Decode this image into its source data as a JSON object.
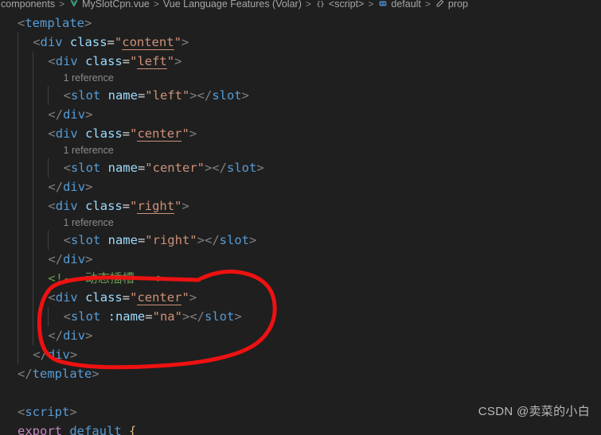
{
  "breadcrumb": {
    "segments": [
      {
        "label": "components",
        "icon": "folder-icon",
        "show_icon": false
      },
      {
        "label": "MySlotCpn.vue",
        "icon": "vue-file-icon",
        "show_icon": true
      },
      {
        "label": "Vue Language Features (Volar)",
        "icon": "extension-icon",
        "show_icon": false
      },
      {
        "label": "<script>",
        "icon": "braces-icon",
        "show_icon": true
      },
      {
        "label": "default",
        "icon": "symbol-object-icon",
        "show_icon": true
      },
      {
        "label": "prop",
        "icon": "symbol-property-icon",
        "show_icon": true
      }
    ],
    "separator": ">"
  },
  "editor": {
    "language": "vue",
    "lines": [
      {
        "type": "code",
        "indent": 1,
        "tokens": [
          {
            "text": "<",
            "cls": "t-bracket"
          },
          {
            "text": "template",
            "cls": "t-tag"
          },
          {
            "text": ">",
            "cls": "t-bracket"
          }
        ]
      },
      {
        "type": "code",
        "indent": 2,
        "tokens": [
          {
            "text": "<",
            "cls": "t-bracket"
          },
          {
            "text": "div",
            "cls": "t-tag"
          },
          {
            "text": " ",
            "cls": "t-eq"
          },
          {
            "text": "class",
            "cls": "t-attr"
          },
          {
            "text": "=",
            "cls": "t-eq"
          },
          {
            "text": "\"",
            "cls": "t-quote"
          },
          {
            "text": "content",
            "cls": "t-str-u"
          },
          {
            "text": "\"",
            "cls": "t-quote"
          },
          {
            "text": ">",
            "cls": "t-bracket"
          }
        ]
      },
      {
        "type": "code",
        "indent": 3,
        "tokens": [
          {
            "text": "<",
            "cls": "t-bracket"
          },
          {
            "text": "div",
            "cls": "t-tag"
          },
          {
            "text": " ",
            "cls": "t-eq"
          },
          {
            "text": "class",
            "cls": "t-attr"
          },
          {
            "text": "=",
            "cls": "t-eq"
          },
          {
            "text": "\"",
            "cls": "t-quote"
          },
          {
            "text": "left",
            "cls": "t-str-u"
          },
          {
            "text": "\"",
            "cls": "t-quote"
          },
          {
            "text": ">",
            "cls": "t-bracket"
          }
        ]
      },
      {
        "type": "codelens",
        "indent": 4,
        "text": "1 reference"
      },
      {
        "type": "code",
        "indent": 4,
        "tokens": [
          {
            "text": "<",
            "cls": "t-bracket"
          },
          {
            "text": "slot",
            "cls": "t-tag"
          },
          {
            "text": " ",
            "cls": "t-eq"
          },
          {
            "text": "name",
            "cls": "t-attr"
          },
          {
            "text": "=",
            "cls": "t-eq"
          },
          {
            "text": "\"",
            "cls": "t-quote"
          },
          {
            "text": "left",
            "cls": "t-str"
          },
          {
            "text": "\"",
            "cls": "t-quote"
          },
          {
            "text": ">",
            "cls": "t-bracket"
          },
          {
            "text": "</",
            "cls": "t-bracket"
          },
          {
            "text": "slot",
            "cls": "t-tag"
          },
          {
            "text": ">",
            "cls": "t-bracket"
          }
        ]
      },
      {
        "type": "code",
        "indent": 3,
        "tokens": [
          {
            "text": "</",
            "cls": "t-bracket"
          },
          {
            "text": "div",
            "cls": "t-tag"
          },
          {
            "text": ">",
            "cls": "t-bracket"
          }
        ]
      },
      {
        "type": "code",
        "indent": 3,
        "tokens": [
          {
            "text": "<",
            "cls": "t-bracket"
          },
          {
            "text": "div",
            "cls": "t-tag"
          },
          {
            "text": " ",
            "cls": "t-eq"
          },
          {
            "text": "class",
            "cls": "t-attr"
          },
          {
            "text": "=",
            "cls": "t-eq"
          },
          {
            "text": "\"",
            "cls": "t-quote"
          },
          {
            "text": "center",
            "cls": "t-str-u"
          },
          {
            "text": "\"",
            "cls": "t-quote"
          },
          {
            "text": ">",
            "cls": "t-bracket"
          }
        ]
      },
      {
        "type": "codelens",
        "indent": 4,
        "text": "1 reference"
      },
      {
        "type": "code",
        "indent": 4,
        "tokens": [
          {
            "text": "<",
            "cls": "t-bracket"
          },
          {
            "text": "slot",
            "cls": "t-tag"
          },
          {
            "text": " ",
            "cls": "t-eq"
          },
          {
            "text": "name",
            "cls": "t-attr"
          },
          {
            "text": "=",
            "cls": "t-eq"
          },
          {
            "text": "\"",
            "cls": "t-quote"
          },
          {
            "text": "center",
            "cls": "t-str"
          },
          {
            "text": "\"",
            "cls": "t-quote"
          },
          {
            "text": ">",
            "cls": "t-bracket"
          },
          {
            "text": "</",
            "cls": "t-bracket"
          },
          {
            "text": "slot",
            "cls": "t-tag"
          },
          {
            "text": ">",
            "cls": "t-bracket"
          }
        ]
      },
      {
        "type": "code",
        "indent": 3,
        "tokens": [
          {
            "text": "</",
            "cls": "t-bracket"
          },
          {
            "text": "div",
            "cls": "t-tag"
          },
          {
            "text": ">",
            "cls": "t-bracket"
          }
        ]
      },
      {
        "type": "code",
        "indent": 3,
        "tokens": [
          {
            "text": "<",
            "cls": "t-bracket"
          },
          {
            "text": "div",
            "cls": "t-tag"
          },
          {
            "text": " ",
            "cls": "t-eq"
          },
          {
            "text": "class",
            "cls": "t-attr"
          },
          {
            "text": "=",
            "cls": "t-eq"
          },
          {
            "text": "\"",
            "cls": "t-quote"
          },
          {
            "text": "right",
            "cls": "t-str-u"
          },
          {
            "text": "\"",
            "cls": "t-quote"
          },
          {
            "text": ">",
            "cls": "t-bracket"
          }
        ]
      },
      {
        "type": "codelens",
        "indent": 4,
        "text": "1 reference"
      },
      {
        "type": "code",
        "indent": 4,
        "tokens": [
          {
            "text": "<",
            "cls": "t-bracket"
          },
          {
            "text": "slot",
            "cls": "t-tag"
          },
          {
            "text": " ",
            "cls": "t-eq"
          },
          {
            "text": "name",
            "cls": "t-attr"
          },
          {
            "text": "=",
            "cls": "t-eq"
          },
          {
            "text": "\"",
            "cls": "t-quote"
          },
          {
            "text": "right",
            "cls": "t-str"
          },
          {
            "text": "\"",
            "cls": "t-quote"
          },
          {
            "text": ">",
            "cls": "t-bracket"
          },
          {
            "text": "</",
            "cls": "t-bracket"
          },
          {
            "text": "slot",
            "cls": "t-tag"
          },
          {
            "text": ">",
            "cls": "t-bracket"
          }
        ]
      },
      {
        "type": "code",
        "indent": 3,
        "tokens": [
          {
            "text": "</",
            "cls": "t-bracket"
          },
          {
            "text": "div",
            "cls": "t-tag"
          },
          {
            "text": ">",
            "cls": "t-bracket"
          }
        ]
      },
      {
        "type": "code",
        "indent": 3,
        "tokens": [
          {
            "text": "<!-- 动态插槽 -->",
            "cls": "t-comment"
          }
        ]
      },
      {
        "type": "code",
        "indent": 3,
        "tokens": [
          {
            "text": "<",
            "cls": "t-bracket"
          },
          {
            "text": "div",
            "cls": "t-tag"
          },
          {
            "text": " ",
            "cls": "t-eq"
          },
          {
            "text": "class",
            "cls": "t-attr"
          },
          {
            "text": "=",
            "cls": "t-eq"
          },
          {
            "text": "\"",
            "cls": "t-quote"
          },
          {
            "text": "center",
            "cls": "t-str-u"
          },
          {
            "text": "\"",
            "cls": "t-quote"
          },
          {
            "text": ">",
            "cls": "t-bracket"
          }
        ]
      },
      {
        "type": "code",
        "indent": 4,
        "tokens": [
          {
            "text": "<",
            "cls": "t-bracket"
          },
          {
            "text": "slot",
            "cls": "t-tag"
          },
          {
            "text": " ",
            "cls": "t-eq"
          },
          {
            "text": ":name",
            "cls": "t-attr"
          },
          {
            "text": "=",
            "cls": "t-eq"
          },
          {
            "text": "\"",
            "cls": "t-quote"
          },
          {
            "text": "na",
            "cls": "t-str"
          },
          {
            "text": "\"",
            "cls": "t-quote"
          },
          {
            "text": ">",
            "cls": "t-bracket"
          },
          {
            "text": "</",
            "cls": "t-bracket"
          },
          {
            "text": "slot",
            "cls": "t-tag"
          },
          {
            "text": ">",
            "cls": "t-bracket"
          }
        ]
      },
      {
        "type": "code",
        "indent": 3,
        "tokens": [
          {
            "text": "</",
            "cls": "t-bracket"
          },
          {
            "text": "div",
            "cls": "t-tag"
          },
          {
            "text": ">",
            "cls": "t-bracket"
          }
        ]
      },
      {
        "type": "code",
        "indent": 2,
        "tokens": [
          {
            "text": "</",
            "cls": "t-bracket"
          },
          {
            "text": "div",
            "cls": "t-tag"
          },
          {
            "text": ">",
            "cls": "t-bracket"
          }
        ]
      },
      {
        "type": "code",
        "indent": 1,
        "tokens": [
          {
            "text": "</",
            "cls": "t-bracket"
          },
          {
            "text": "template",
            "cls": "t-tag"
          },
          {
            "text": ">",
            "cls": "t-bracket"
          }
        ]
      },
      {
        "type": "blank",
        "indent": 1,
        "tokens": []
      },
      {
        "type": "code",
        "indent": 1,
        "tokens": [
          {
            "text": "<",
            "cls": "t-bracket"
          },
          {
            "text": "script",
            "cls": "t-tag"
          },
          {
            "text": ">",
            "cls": "t-bracket"
          }
        ]
      },
      {
        "type": "code",
        "indent": 1,
        "tokens": [
          {
            "text": "export",
            "cls": "t-kw"
          },
          {
            "text": " ",
            "cls": "t-eq"
          },
          {
            "text": "default",
            "cls": "t-tag"
          },
          {
            "text": " ",
            "cls": "t-eq"
          },
          {
            "text": "{",
            "cls": "t-brace"
          }
        ]
      }
    ]
  },
  "annotation": {
    "type": "hand-drawn-ellipse",
    "color": "#ee1111",
    "stroke_width": 5,
    "target": "dynamic slot block"
  },
  "watermark": {
    "text": "CSDN @卖菜的小白"
  },
  "colors": {
    "background": "#1f1f1f",
    "tag": "#569cd6",
    "attribute": "#9cdcfe",
    "string": "#ce9178",
    "comment": "#6a9955",
    "bracket": "#808080",
    "keyword": "#c586c0",
    "brace": "#d7ba7d",
    "codelens": "#8b8b8b",
    "annotation_red": "#ee1111",
    "vue_green": "#41b883"
  }
}
